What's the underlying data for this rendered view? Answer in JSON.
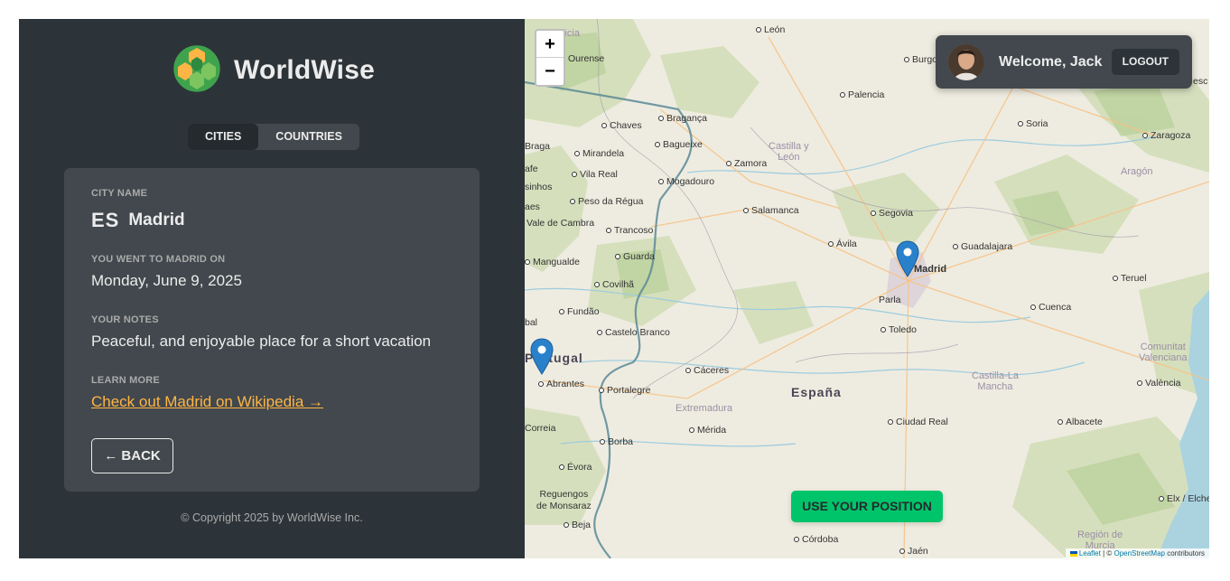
{
  "brand": {
    "name": "WorldWise"
  },
  "tabs": [
    {
      "label": "Cities",
      "active": true
    },
    {
      "label": "Countries",
      "active": false
    }
  ],
  "city": {
    "name_label": "City name",
    "flag_code": "ES",
    "name": "Madrid",
    "date_label": "You went to Madrid on",
    "date": "Monday, June 9, 2025",
    "notes_label": "Your notes",
    "notes": "Peaceful, and enjoyable place for a short vacation",
    "learn_label": "Learn more",
    "wiki_link": "Check out Madrid on Wikipedia →",
    "back_label": "← BACK"
  },
  "footer": {
    "copyright": "© Copyright 2025 by WorldWise Inc."
  },
  "map": {
    "zoom_in": "+",
    "zoom_out": "−",
    "country": "España",
    "markers": [
      "Madrid",
      "Portugal"
    ],
    "places": {
      "leon": "León",
      "ourense": "Ourense",
      "burgos": "Burgos",
      "palencia": "Palencia",
      "chaves": "Chaves",
      "braganca": "Bragança",
      "braga": "Braga",
      "mirandela": "Mirandela",
      "bagueixe": "Bagueixe",
      "zamora": "Zamora",
      "soria": "Soria",
      "zaragoza": "Zaragoza",
      "vilareal": "Vila Real",
      "mogadouro": "Mogadouro",
      "pesoregua": "Peso da Régua",
      "valecambra": "Vale de Cambra",
      "salamanca": "Salamanca",
      "segovia": "Segovia",
      "trancoso": "Trancoso",
      "avila": "Ávila",
      "guadalajara": "Guadalajara",
      "mangualde": "Mangualde",
      "guarda": "Guarda",
      "madrid": "Madrid",
      "teruel": "Teruel",
      "covilha": "Covilhã",
      "parla": "Parla",
      "fundao": "Fundão",
      "cuenca": "Cuenca",
      "castelobranco": "Castelo Branco",
      "toledo": "Toledo",
      "portugal": "Portugal",
      "caceres": "Cáceres",
      "abrantes": "Abrantes",
      "portalegre": "Portalegre",
      "valencia": "València",
      "merida": "Mérida",
      "ciudadreal": "Ciudad Real",
      "albacete": "Albacete",
      "correia": "Correia",
      "borba": "Borba",
      "evora": "Évora",
      "reguengos": "Reguengos\nde Monsaraz",
      "beja": "Beja",
      "elx": "Elx / Elche",
      "cordoba": "Córdoba",
      "jaen": "Jaén",
      "aragon": "Aragón",
      "castilla": "Castilla y\nLeón",
      "extremadura": "Extremadura",
      "castillamancha": "Castilla-La\nMancha",
      "comunitat": "Comunitat\nValenciana",
      "murcia": "Región de\nMurcia",
      "galicia": "licia",
      "sinhos": "sinhos",
      "afe": "afe",
      "aes": "aes",
      "bal": "bal",
      "esc": "esc"
    },
    "use_position": "USE YOUR POSITION",
    "attribution": {
      "leaflet": "Leaflet",
      "sep": " | © ",
      "osm": "OpenStreetMap",
      "rest": " contributors"
    }
  },
  "user": {
    "welcome": "Welcome, Jack",
    "logout": "Logout"
  },
  "colors": {
    "accent": "#00c46a",
    "link": "#ffb545",
    "sidebar": "#2d3439",
    "card": "#42484d"
  }
}
